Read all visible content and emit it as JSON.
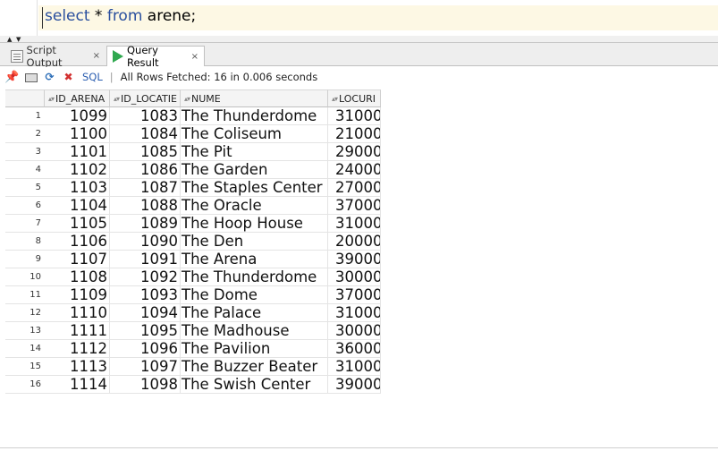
{
  "editor": {
    "kw_select": "select",
    "star": " * ",
    "kw_from": "from",
    "table": " arene;"
  },
  "tabs": [
    {
      "label": "Script Output",
      "close": "×"
    },
    {
      "label": "Query Result",
      "close": "×"
    }
  ],
  "toolbar": {
    "sql_label": "SQL",
    "separator": "|",
    "status": "All Rows Fetched: 16 in 0.006 seconds"
  },
  "columns": [
    "ID_ARENA",
    "ID_LOCATIE",
    "NUME",
    "LOCURI"
  ],
  "rows": [
    {
      "n": "1",
      "id_arena": "1099",
      "id_locatie": "1083",
      "nume": "The Thunderdome",
      "locuri": "31000"
    },
    {
      "n": "2",
      "id_arena": "1100",
      "id_locatie": "1084",
      "nume": "The Coliseum",
      "locuri": "21000"
    },
    {
      "n": "3",
      "id_arena": "1101",
      "id_locatie": "1085",
      "nume": "The Pit",
      "locuri": "29000"
    },
    {
      "n": "4",
      "id_arena": "1102",
      "id_locatie": "1086",
      "nume": "The Garden",
      "locuri": "24000"
    },
    {
      "n": "5",
      "id_arena": "1103",
      "id_locatie": "1087",
      "nume": "The Staples Center",
      "locuri": "27000"
    },
    {
      "n": "6",
      "id_arena": "1104",
      "id_locatie": "1088",
      "nume": "The Oracle",
      "locuri": "37000"
    },
    {
      "n": "7",
      "id_arena": "1105",
      "id_locatie": "1089",
      "nume": "The Hoop House",
      "locuri": "31000"
    },
    {
      "n": "8",
      "id_arena": "1106",
      "id_locatie": "1090",
      "nume": "The Den",
      "locuri": "20000"
    },
    {
      "n": "9",
      "id_arena": "1107",
      "id_locatie": "1091",
      "nume": "The Arena",
      "locuri": "39000"
    },
    {
      "n": "10",
      "id_arena": "1108",
      "id_locatie": "1092",
      "nume": "The Thunderdome",
      "locuri": "30000"
    },
    {
      "n": "11",
      "id_arena": "1109",
      "id_locatie": "1093",
      "nume": "The Dome",
      "locuri": "37000"
    },
    {
      "n": "12",
      "id_arena": "1110",
      "id_locatie": "1094",
      "nume": "The Palace",
      "locuri": "31000"
    },
    {
      "n": "13",
      "id_arena": "1111",
      "id_locatie": "1095",
      "nume": "The Madhouse",
      "locuri": "30000"
    },
    {
      "n": "14",
      "id_arena": "1112",
      "id_locatie": "1096",
      "nume": "The Pavilion",
      "locuri": "36000"
    },
    {
      "n": "15",
      "id_arena": "1113",
      "id_locatie": "1097",
      "nume": "The Buzzer Beater",
      "locuri": "31000"
    },
    {
      "n": "16",
      "id_arena": "1114",
      "id_locatie": "1098",
      "nume": "The Swish Center",
      "locuri": "39000"
    }
  ],
  "icons": {
    "pin": "pin-icon",
    "print": "print-icon",
    "refresh": "refresh-icon",
    "clear": "clear-icon",
    "script": "script-output-icon",
    "run": "run-icon"
  },
  "colors": {
    "keyword": "#2a4f9e",
    "editor_line": "#fdf8e4",
    "run_green": "#2fa84f",
    "link_blue": "#2a5db0"
  }
}
